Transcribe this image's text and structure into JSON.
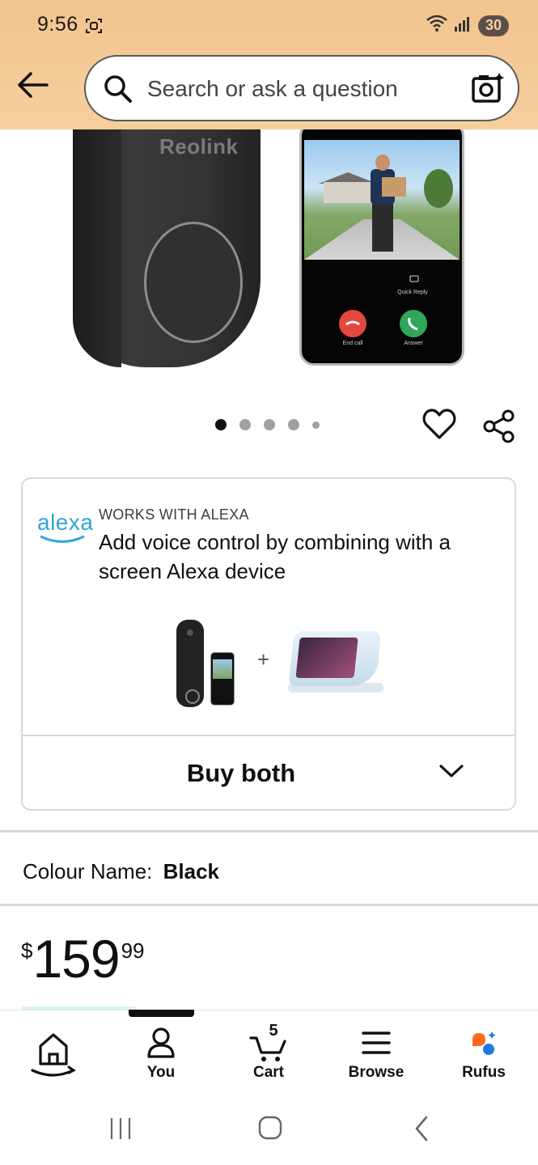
{
  "status_bar": {
    "time": "9:56",
    "battery": "30"
  },
  "header": {
    "search_placeholder": "Search or ask a question"
  },
  "product": {
    "brand_on_device": "Reolink",
    "phone_quick_reply": "Quick Reply",
    "phone_end_call": "End call",
    "phone_answer": "Answer",
    "carousel": {
      "total_images": 5,
      "active_index": 0
    }
  },
  "alexa_card": {
    "logo_text": "alexa",
    "kicker": "WORKS WITH ALEXA",
    "title": "Add voice control by combining with a screen Alexa device",
    "plus": "+",
    "buy_both_label": "Buy both"
  },
  "colour": {
    "label": "Colour Name:",
    "value": "Black"
  },
  "price": {
    "symbol": "$",
    "whole": "159",
    "fraction": "99"
  },
  "bottom_nav": {
    "items": [
      {
        "label": "",
        "icon": "home-icon"
      },
      {
        "label": "You",
        "icon": "person-icon"
      },
      {
        "label": "Cart",
        "icon": "cart-icon",
        "count": "5"
      },
      {
        "label": "Browse",
        "icon": "menu-icon"
      },
      {
        "label": "Rufus",
        "icon": "rufus-icon"
      }
    ]
  },
  "colors": {
    "header_bg": "#f6cf9d",
    "alexa_blue": "#2fa6d8",
    "rufus_orange": "#ff6b1a",
    "rufus_blue": "#1f7ae0"
  }
}
